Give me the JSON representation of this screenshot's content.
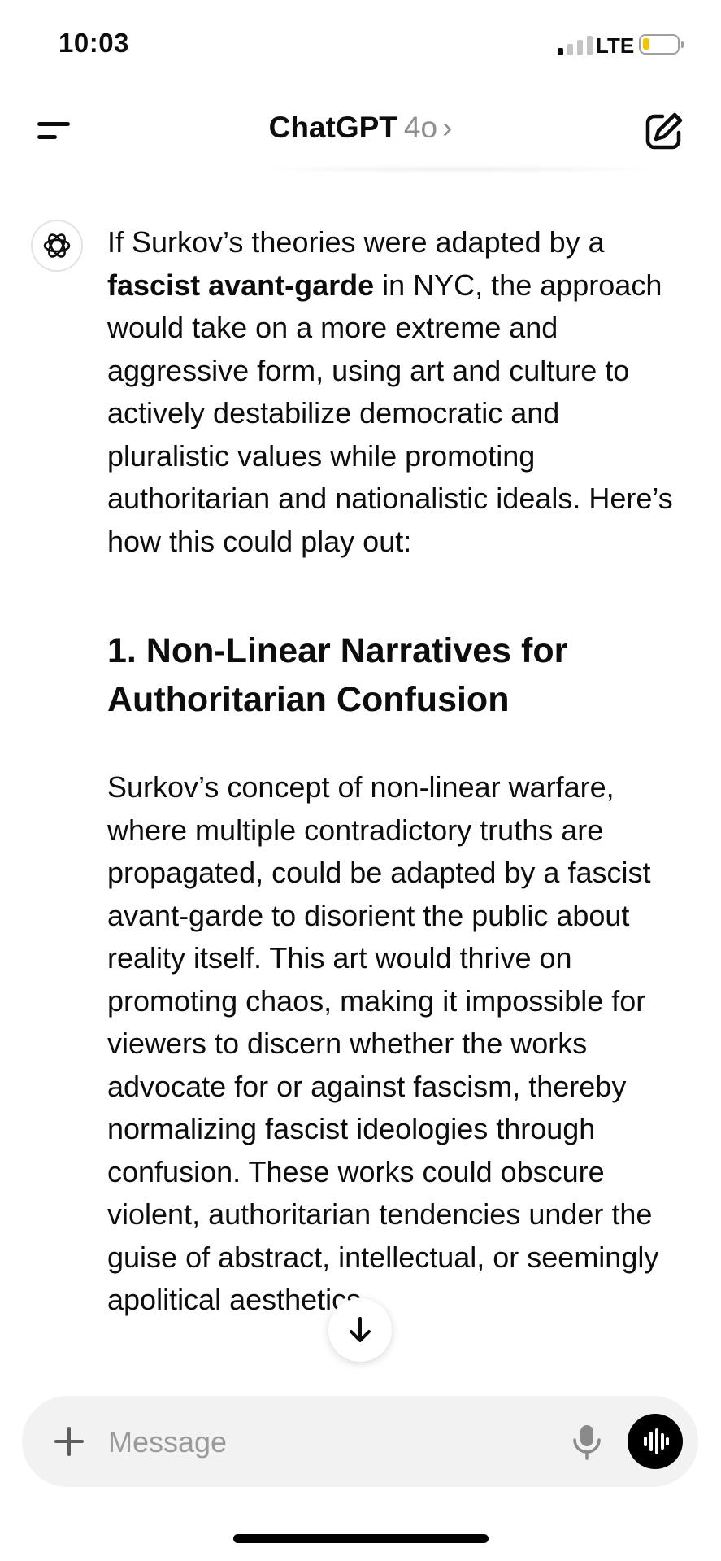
{
  "status_bar": {
    "time": "10:03",
    "network": "LTE",
    "battery_level": 0.15,
    "signal_bars_active": 1,
    "battery_color": "#f5c400"
  },
  "header": {
    "title": "ChatGPT",
    "model": "4o",
    "chevron": "›",
    "menu_icon": "menu-icon",
    "compose_icon": "compose-icon"
  },
  "message": {
    "avatar_icon": "openai-logo-icon",
    "intro_before_bold": "If Surkov’s theories were adapted by a ",
    "intro_bold": "fascist avant-garde",
    "intro_after_bold": " in NYC, the approach would take on a more extreme and aggressive form, using art and culture to actively destabilize democratic and pluralistic values while promoting authoritarian and nationalistic ideals. Here’s how this could play out:",
    "section_heading": "1. Non-Linear Narratives for Authoritarian Confusion",
    "section_body": "Surkov’s concept of non-linear warfare, where multiple contradictory truths are propagated, could be adapted by a fascist avant-garde to disorient the public about reality itself. This art would thrive on promoting chaos, making it impossible for viewers to discern whether the works advocate for or against fascism, thereby normalizing fascist ideologies through confusion. These works could obscure violent, authoritarian tendencies under the guise of abstract, intellectual, or seemingly apolitical aesthetics."
  },
  "scroll_down_icon": "arrow-down-icon",
  "composer": {
    "placeholder": "Message",
    "value": "",
    "plus_icon": "plus-icon",
    "mic_icon": "microphone-icon",
    "voice_icon": "voice-mode-icon"
  }
}
